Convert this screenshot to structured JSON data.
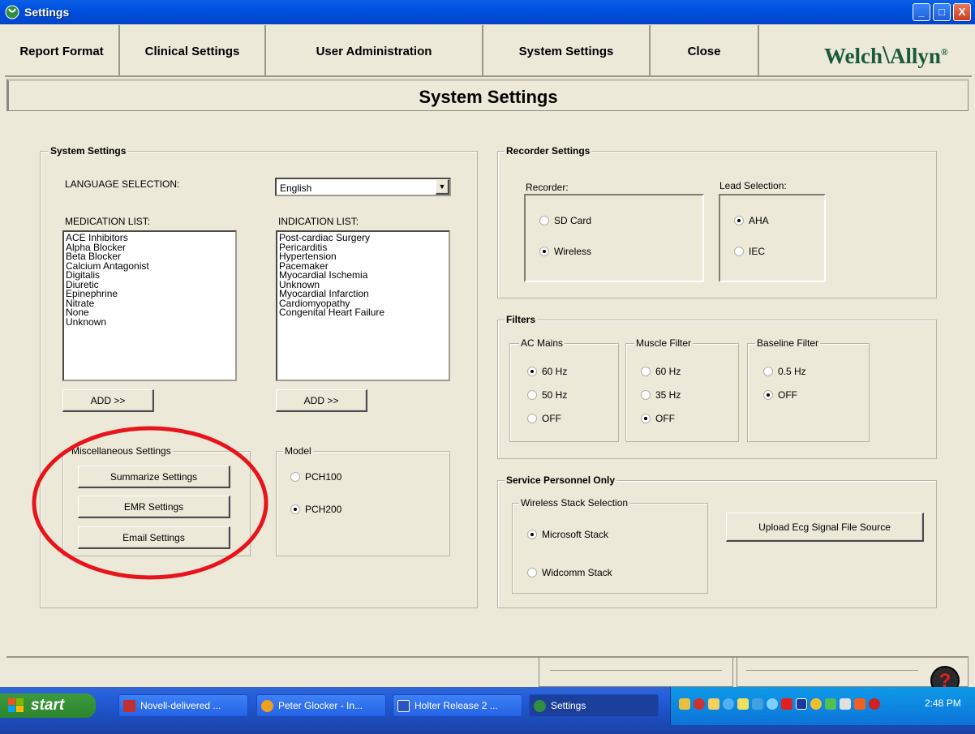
{
  "window": {
    "title": "Settings",
    "minimize": "_",
    "maximize": "□",
    "close": "X"
  },
  "menubar": {
    "tabs": [
      "Report Format",
      "Clinical Settings",
      "User Administration",
      "System Settings",
      "Close"
    ],
    "logo": "Welch Allyn"
  },
  "page_title": "System Settings",
  "system_settings": {
    "group_label": "System Settings",
    "language_label": "LANGUAGE SELECTION:",
    "language_value": "English",
    "medication_label": "MEDICATION LIST:",
    "medication_items": [
      "ACE Inhibitors",
      "Alpha Blocker",
      "Beta Blocker",
      "Calcium Antagonist",
      "Digitalis",
      "Diuretic",
      "Epinephrine",
      "Nitrate",
      "None",
      "Unknown"
    ],
    "indication_label": "INDICATION LIST:",
    "indication_items": [
      "Post-cardiac Surgery",
      "Pericarditis",
      "Hypertension",
      "Pacemaker",
      "Myocardial Ischemia",
      "Unknown",
      "Myocardial Infarction",
      "Cardiomyopathy",
      "Congenital Heart Failure"
    ],
    "add_button": "ADD >>",
    "misc_label": "Miscellaneous Settings",
    "summarize_button": "Summarize Settings",
    "emr_button": "EMR Settings",
    "email_button": "Email Settings",
    "model_label": "Model",
    "model_options": [
      "PCH100",
      "PCH200"
    ],
    "model_selected": "PCH200"
  },
  "recorder_settings": {
    "group_label": "Recorder Settings",
    "recorder_label": "Recorder:",
    "recorder_options": [
      "SD Card",
      "Wireless"
    ],
    "recorder_selected": "Wireless",
    "lead_label": "Lead Selection:",
    "lead_options": [
      "AHA",
      "IEC"
    ],
    "lead_selected": "AHA"
  },
  "filters": {
    "group_label": "Filters",
    "ac_mains_label": "AC Mains",
    "ac_mains_options": [
      "60 Hz",
      "50 Hz",
      "OFF"
    ],
    "ac_mains_selected": "60 Hz",
    "muscle_label": "Muscle Filter",
    "muscle_options": [
      "60 Hz",
      "35 Hz",
      "OFF"
    ],
    "muscle_selected": "OFF",
    "baseline_label": "Baseline Filter",
    "baseline_options": [
      "0.5 Hz",
      "OFF"
    ],
    "baseline_selected": "OFF"
  },
  "service": {
    "group_label": "Service Personnel Only",
    "stack_label": "Wireless Stack Selection",
    "stack_options": [
      "Microsoft Stack",
      "Widcomm Stack"
    ],
    "stack_selected": "Microsoft Stack",
    "upload_button": "Upload Ecg Signal File Source"
  },
  "taskbar": {
    "start_label": "start",
    "tasks": [
      "Novell-delivered ...",
      "Peter Glocker - In...",
      "Holter Release 2 ...",
      "Settings"
    ],
    "active_task": "Settings",
    "clock": "2:48 PM"
  },
  "colors": {
    "title_bar": "#0A5FE6",
    "window_bg": "#ECE9D8",
    "annotation_circle": "#E8141C",
    "logo": "#1A5A3A",
    "taskbar": "#245EDB"
  }
}
